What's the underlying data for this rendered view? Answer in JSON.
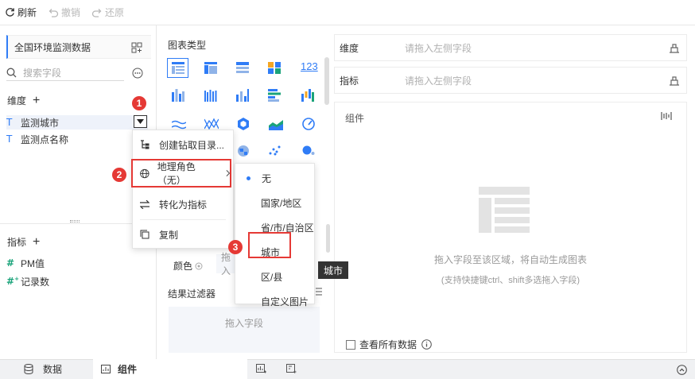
{
  "toolbar": {
    "refresh": "刷新",
    "undo": "撤销",
    "redo": "还原"
  },
  "left": {
    "dataset": "全国环境监测数据",
    "search_placeholder": "搜索字段",
    "dimension_title": "维度",
    "dimensions": [
      {
        "label": "监测城市"
      },
      {
        "label": "监测点名称"
      }
    ],
    "measure_title": "指标",
    "measures": [
      {
        "label": "PM值"
      },
      {
        "label": "记录数"
      }
    ]
  },
  "mid": {
    "chart_type_title": "图表类型",
    "color_label": "颜色",
    "color_drop": "拖入",
    "filter_title": "结果过滤器",
    "filter_drop": "拖入字段",
    "text_123": "123"
  },
  "right": {
    "dim_label": "维度",
    "dim_placeholder": "请拖入左侧字段",
    "measure_label": "指标",
    "measure_placeholder": "请拖入左侧字段",
    "component_label": "组件",
    "hint1": "拖入字段至该区域，将自动生成图表",
    "hint2": "(支持快捷键ctrl、shift多选拖入字段)",
    "view_all": "查看所有数据"
  },
  "context_menu": {
    "items": [
      {
        "label": "创建钻取目录..."
      },
      {
        "label": "地理角色（无）"
      },
      {
        "label": "转化为指标"
      },
      {
        "label": "复制"
      }
    ]
  },
  "submenu": {
    "items": [
      {
        "label": "无"
      },
      {
        "label": "国家/地区"
      },
      {
        "label": "省/市/自治区"
      },
      {
        "label": "城市"
      },
      {
        "label": "区/县"
      },
      {
        "label": "自定义图片"
      }
    ]
  },
  "tooltip": "城市",
  "badges": [
    "1",
    "2",
    "3"
  ],
  "bottom": {
    "data_tab": "数据",
    "component_tab": "组件"
  },
  "colors": {
    "accent": "#2f7cf6",
    "red": "#e53935"
  }
}
